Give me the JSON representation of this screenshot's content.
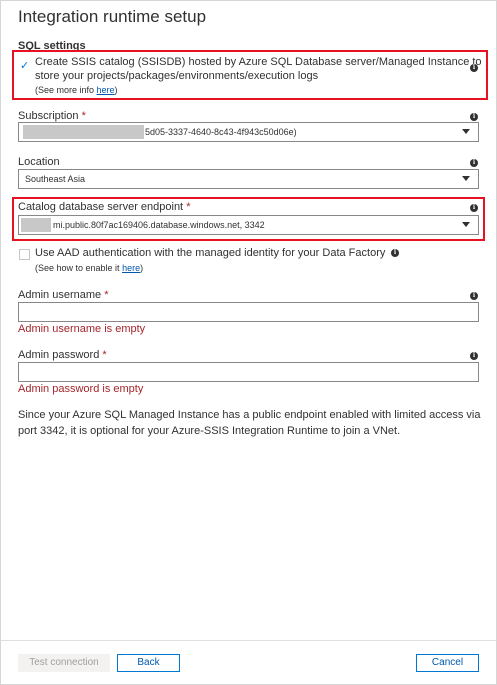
{
  "title": "Integration runtime setup",
  "sql_settings": {
    "section_title": "SQL settings",
    "create_catalog": {
      "checked": true,
      "label_line1": "Create SSIS catalog (SSISDB) hosted by Azure SQL Database server/Managed Instance to",
      "label_line2": "store your projects/packages/environments/execution logs",
      "more_info_prefix": "(See more info ",
      "more_info_link": "here",
      "more_info_suffix": ")"
    },
    "subscription": {
      "label": "Subscription",
      "required_marker": "*",
      "value_visible": "5d05-3337-4640-8c43-4f943c50d06e)"
    },
    "location": {
      "label": "Location",
      "value": "Southeast Asia"
    },
    "catalog_endpoint": {
      "label": "Catalog database server endpoint",
      "required_marker": "*",
      "value_visible": "mi.public.80f7ac169406.database.windows.net, 3342"
    },
    "aad_auth": {
      "checked": false,
      "label": "Use AAD authentication with the managed identity for your Data Factory",
      "help_prefix": "(See how to enable it ",
      "help_link": "here",
      "help_suffix": ")"
    },
    "admin_username": {
      "label": "Admin username",
      "required_marker": "*",
      "value": "",
      "error": "Admin username is empty"
    },
    "admin_password": {
      "label": "Admin password",
      "required_marker": "*",
      "value": "",
      "error": "Admin password is empty"
    },
    "note_line1": "Since your Azure SQL Managed Instance has a public endpoint enabled with limited access via",
    "note_line2": "port 3342, it is optional for your Azure-SSIS Integration Runtime to join a VNet."
  },
  "footer": {
    "test_connection": "Test connection",
    "back": "Back",
    "cancel": "Cancel"
  },
  "icons": {
    "info": "info-icon",
    "check": "checkmark-icon",
    "dropdown": "chevron-down-icon"
  },
  "colors": {
    "highlight": "#e81123",
    "error": "#a4262c",
    "accent": "#0078d4"
  }
}
